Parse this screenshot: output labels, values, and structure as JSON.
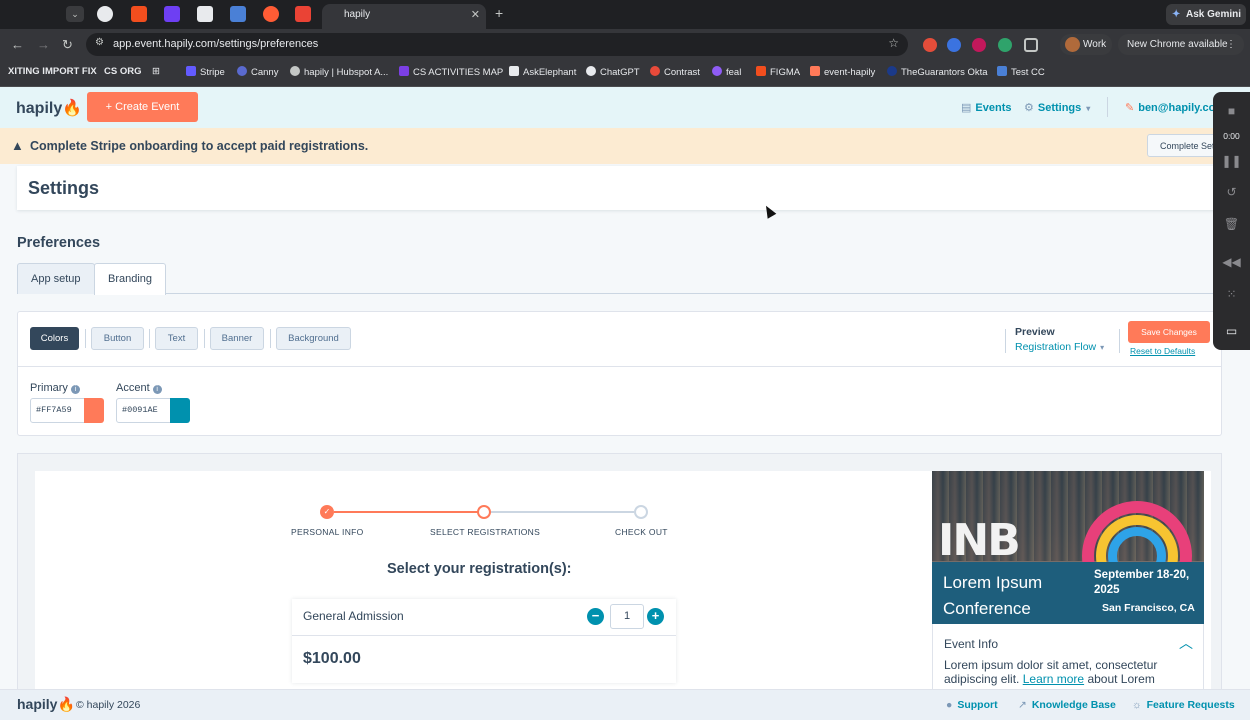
{
  "browser": {
    "active_tab_title": "hapily",
    "url": "app.event.hapily.com/settings/preferences",
    "ask_gemini": "Ask Gemini",
    "profile": "Work",
    "update_notice": "New Chrome available",
    "bookmarks": [
      "XITING IMPORT FIX",
      "CS ORG",
      "Stripe",
      "Canny",
      "hapily | Hubspot A...",
      "CS ACTIVITIES MAP",
      "AskElephant",
      "ChatGPT",
      "Contrast",
      "feal",
      "FIGMA",
      "event-hapily",
      "TheGuarantors Okta",
      "Test CC"
    ]
  },
  "header": {
    "logo": "hapily",
    "create_event": "+ Create Event",
    "events": "Events",
    "settings": "Settings",
    "user_email": "ben@hapily.com"
  },
  "warning": {
    "message": "Complete Stripe onboarding to accept paid registrations.",
    "button": "Complete Setup"
  },
  "page": {
    "title": "Settings",
    "section": "Preferences",
    "tabs": [
      "App setup",
      "Branding"
    ],
    "active_tab": "Branding"
  },
  "branding": {
    "subtabs": [
      "Colors",
      "Button",
      "Text",
      "Banner",
      "Background"
    ],
    "active_subtab": "Colors",
    "preview_label": "Preview",
    "preview_value": "Registration Flow",
    "save_button": "Save Changes",
    "reset_link": "Reset to Defaults",
    "primary_label": "Primary",
    "primary_value": "#FF7A59",
    "accent_label": "Accent",
    "accent_value": "#0091AE"
  },
  "preview": {
    "steps": [
      "PERSONAL INFO",
      "SELECT REGISTRATIONS",
      "CHECK OUT"
    ],
    "heading": "Select your registration(s):",
    "ticket_name": "General Admission",
    "quantity": "1",
    "price": "$100.00",
    "event_name": "Lorem Ipsum Conference",
    "event_date": "September 18-20, 2025",
    "event_location": "San Francisco, CA",
    "event_info_heading": "Event Info",
    "event_info_text_pre": "Lorem ipsum dolor sit amet, consectetur adipiscing elit.",
    "event_info_link": "Learn more",
    "event_info_text_post": "about Lorem"
  },
  "footer": {
    "logo": "hapily",
    "copyright": "© hapily 2026",
    "support": "Support",
    "knowledge_base": "Knowledge Base",
    "feature_requests": "Feature Requests"
  },
  "recorder": {
    "time": "0:00"
  },
  "colors": {
    "brand_orange": "#FF7A59",
    "brand_teal": "#0091AE",
    "header_bg": "#E5F5F8",
    "warning_bg": "#FCEBD2"
  }
}
